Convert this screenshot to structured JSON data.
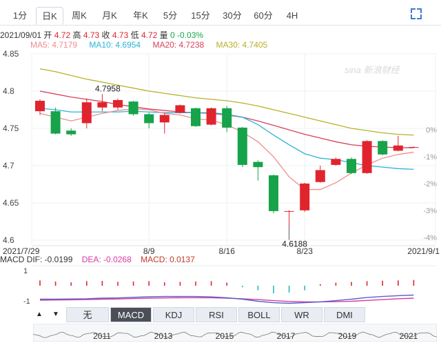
{
  "tabs": [
    {
      "label": "1分",
      "active": false
    },
    {
      "label": "日K",
      "active": true
    },
    {
      "label": "周K",
      "active": false
    },
    {
      "label": "月K",
      "active": false
    },
    {
      "label": "年K",
      "active": false
    },
    {
      "label": "5分",
      "active": false
    },
    {
      "label": "15分",
      "active": false
    },
    {
      "label": "30分",
      "active": false
    },
    {
      "label": "60分",
      "active": false
    },
    {
      "label": "4H",
      "active": false
    }
  ],
  "info": {
    "date": "2021/09/01",
    "open_label": "开",
    "open": "4.72",
    "high_label": "高",
    "high": "4.73",
    "close_label": "收",
    "close": "4.73",
    "low_label": "低",
    "low": "4.72",
    "vol_label": "量",
    "vol": "0",
    "change": "-0.03%"
  },
  "ma": {
    "ma5": "MA5: 4.7179",
    "ma10": "MA10: 4.6954",
    "ma20": "MA20: 4.7238",
    "ma30": "MA30: 4.7405",
    "colors": {
      "ma5": "#f08c8c",
      "ma10": "#2bb3d6",
      "ma20": "#d9405a",
      "ma30": "#b7b02a"
    }
  },
  "watermark": "sina 新浪财经",
  "macd_info": {
    "dif": "MACD  DIF: -0.0199",
    "dea": "DEA: -0.0268",
    "macd": "MACD: 0.0137"
  },
  "indicators": [
    {
      "label": "无",
      "active": false
    },
    {
      "label": "MACD",
      "active": true
    },
    {
      "label": "KDJ",
      "active": false
    },
    {
      "label": "RSI",
      "active": false
    },
    {
      "label": "BOLL",
      "active": false
    },
    {
      "label": "WR",
      "active": false
    },
    {
      "label": "DMI",
      "active": false
    }
  ],
  "arrows": {
    "up": "▲",
    "down": "▼"
  },
  "overview_years": [
    "2011",
    "2013",
    "2015",
    "2017",
    "2019",
    "2021"
  ],
  "colors": {
    "up": "#e0242e",
    "down": "#16a34a",
    "accent": "#3b7bd4"
  },
  "chart_data": {
    "type": "candlestick",
    "y_ticks": [
      "4.85",
      "4.8",
      "4.75",
      "4.7",
      "4.65",
      "4.6"
    ],
    "ylim": [
      4.6,
      4.85
    ],
    "pct_ticks": [
      "0%",
      "-1%",
      "-2%",
      "-3%",
      "-4%"
    ],
    "x_labels": [
      {
        "label": "2021/7/29",
        "index": 0
      },
      {
        "label": "8/9",
        "index": 7
      },
      {
        "label": "8/16",
        "index": 12
      },
      {
        "label": "8/23",
        "index": 17
      },
      {
        "label": "2021/9/1",
        "index": 24
      }
    ],
    "candles": [
      {
        "o": 4.773,
        "c": 4.787,
        "h": 4.789,
        "l": 4.768
      },
      {
        "o": 4.773,
        "c": 4.743,
        "h": 4.778,
        "l": 4.742
      },
      {
        "o": 4.747,
        "c": 4.742,
        "h": 4.75,
        "l": 4.74
      },
      {
        "o": 4.757,
        "c": 4.785,
        "h": 4.79,
        "l": 4.75
      },
      {
        "o": 4.778,
        "c": 4.785,
        "h": 4.796,
        "l": 4.773
      },
      {
        "o": 4.778,
        "c": 4.788,
        "h": 4.79,
        "l": 4.775
      },
      {
        "o": 4.786,
        "c": 4.769,
        "h": 4.787,
        "l": 4.767
      },
      {
        "o": 4.769,
        "c": 4.757,
        "h": 4.771,
        "l": 4.75
      },
      {
        "o": 4.758,
        "c": 4.768,
        "h": 4.77,
        "l": 4.743
      },
      {
        "o": 4.771,
        "c": 4.781,
        "h": 4.782,
        "l": 4.77
      },
      {
        "o": 4.777,
        "c": 4.753,
        "h": 4.778,
        "l": 4.752
      },
      {
        "o": 4.755,
        "c": 4.777,
        "h": 4.778,
        "l": 4.754
      },
      {
        "o": 4.777,
        "c": 4.751,
        "h": 4.78,
        "l": 4.745
      },
      {
        "o": 4.751,
        "c": 4.701,
        "h": 4.752,
        "l": 4.698
      },
      {
        "o": 4.705,
        "c": 4.698,
        "h": 4.707,
        "l": 4.68
      },
      {
        "o": 4.687,
        "c": 4.639,
        "h": 4.688,
        "l": 4.636
      },
      {
        "o": 4.639,
        "c": 4.639,
        "h": 4.64,
        "l": 4.619
      },
      {
        "o": 4.64,
        "c": 4.676,
        "h": 4.677,
        "l": 4.638
      },
      {
        "o": 4.678,
        "c": 4.694,
        "h": 4.7,
        "l": 4.677
      },
      {
        "o": 4.701,
        "c": 4.709,
        "h": 4.711,
        "l": 4.7
      },
      {
        "o": 4.709,
        "c": 4.69,
        "h": 4.711,
        "l": 4.689
      },
      {
        "o": 4.69,
        "c": 4.733,
        "h": 4.734,
        "l": 4.689
      },
      {
        "o": 4.733,
        "c": 4.715,
        "h": 4.734,
        "l": 4.714
      },
      {
        "o": 4.72,
        "c": 4.727,
        "h": 4.74,
        "l": 4.719
      },
      {
        "o": 4.725,
        "c": 4.725,
        "h": 4.726,
        "l": 4.724
      }
    ],
    "ma_lines": {
      "ma5": [
        4.77,
        4.765,
        4.76,
        4.765,
        4.77,
        4.774,
        4.776,
        4.775,
        4.77,
        4.768,
        4.763,
        4.761,
        4.755,
        4.745,
        4.732,
        4.712,
        4.685,
        4.668,
        4.668,
        4.677,
        4.69,
        4.701,
        4.71,
        4.715,
        4.718
      ],
      "ma10": [
        4.777,
        4.775,
        4.772,
        4.772,
        4.772,
        4.772,
        4.773,
        4.772,
        4.771,
        4.771,
        4.771,
        4.771,
        4.769,
        4.765,
        4.755,
        4.741,
        4.728,
        4.716,
        4.71,
        4.708,
        4.704,
        4.7,
        4.698,
        4.696,
        4.695
      ],
      "ma20": [
        4.8,
        4.796,
        4.792,
        4.789,
        4.786,
        4.782,
        4.779,
        4.776,
        4.774,
        4.772,
        4.771,
        4.77,
        4.768,
        4.765,
        4.76,
        4.754,
        4.748,
        4.742,
        4.737,
        4.732,
        4.728,
        4.726,
        4.725,
        4.724,
        4.724
      ],
      "ma30": [
        4.83,
        4.826,
        4.821,
        4.816,
        4.812,
        4.808,
        4.804,
        4.8,
        4.797,
        4.794,
        4.791,
        4.789,
        4.787,
        4.784,
        4.78,
        4.775,
        4.77,
        4.765,
        4.76,
        4.755,
        4.75,
        4.747,
        4.744,
        4.742,
        4.741
      ]
    },
    "annotations": [
      {
        "label": "4.7958",
        "index": 4,
        "value": 4.796
      },
      {
        "label": "4.6188",
        "index": 16,
        "value": 4.619
      }
    ],
    "macd": {
      "y_ticks": [
        "1",
        "-1"
      ],
      "bars": [
        0.35,
        0.28,
        0.22,
        0.3,
        0.32,
        0.26,
        0.28,
        0.3,
        0.22,
        0.25,
        0.28,
        0.3,
        0.2,
        -0.1,
        -0.3,
        -0.5,
        -0.45,
        -0.3,
        0.1,
        0.2,
        0.25,
        0.3,
        0.33,
        0.35,
        0.38
      ],
      "dif": [
        -0.05,
        -0.05,
        -0.04,
        -0.03,
        0.0,
        0.01,
        0.04,
        0.07,
        0.08,
        0.08,
        0.08,
        0.06,
        0.02,
        -0.05,
        -0.15,
        -0.22,
        -0.25,
        -0.22,
        -0.18,
        -0.12,
        -0.05,
        0.03,
        0.08,
        0.12,
        0.15
      ],
      "dea": [
        -0.1,
        -0.09,
        -0.08,
        -0.07,
        -0.05,
        -0.04,
        -0.02,
        0.0,
        0.01,
        0.02,
        0.02,
        0.02,
        0.0,
        -0.03,
        -0.07,
        -0.12,
        -0.16,
        -0.18,
        -0.18,
        -0.17,
        -0.15,
        -0.11,
        -0.07,
        -0.03,
        0.0
      ]
    }
  }
}
